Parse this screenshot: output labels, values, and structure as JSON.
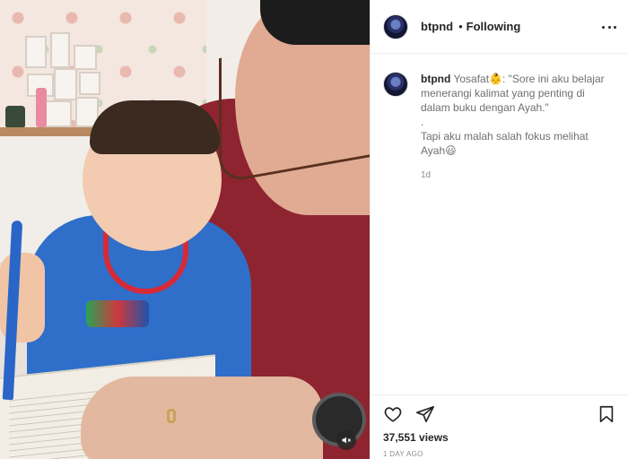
{
  "post": {
    "username": "btpnd",
    "separator": "•",
    "follow_status": "Following",
    "caption": {
      "username": "btpnd",
      "line1": "Yosafat👶: \"Sore ini aku belajar menerangi kalimat yang penting di dalam buku dengan Ayah.\"",
      "line2": ".",
      "line3": "Tapi aku malah salah fokus melihat Ayah😃"
    },
    "caption_time": "1d",
    "views": "37,551 views",
    "date": "1 DAY AGO"
  },
  "icons": {
    "avatar": "profile-avatar",
    "more": "more-options-icon",
    "like": "heart-icon",
    "share": "send-icon",
    "save": "bookmark-icon",
    "mute": "speaker-muted-icon"
  },
  "colors": {
    "text": "#262626",
    "muted": "#8e8e8e",
    "border": "#efefef"
  }
}
